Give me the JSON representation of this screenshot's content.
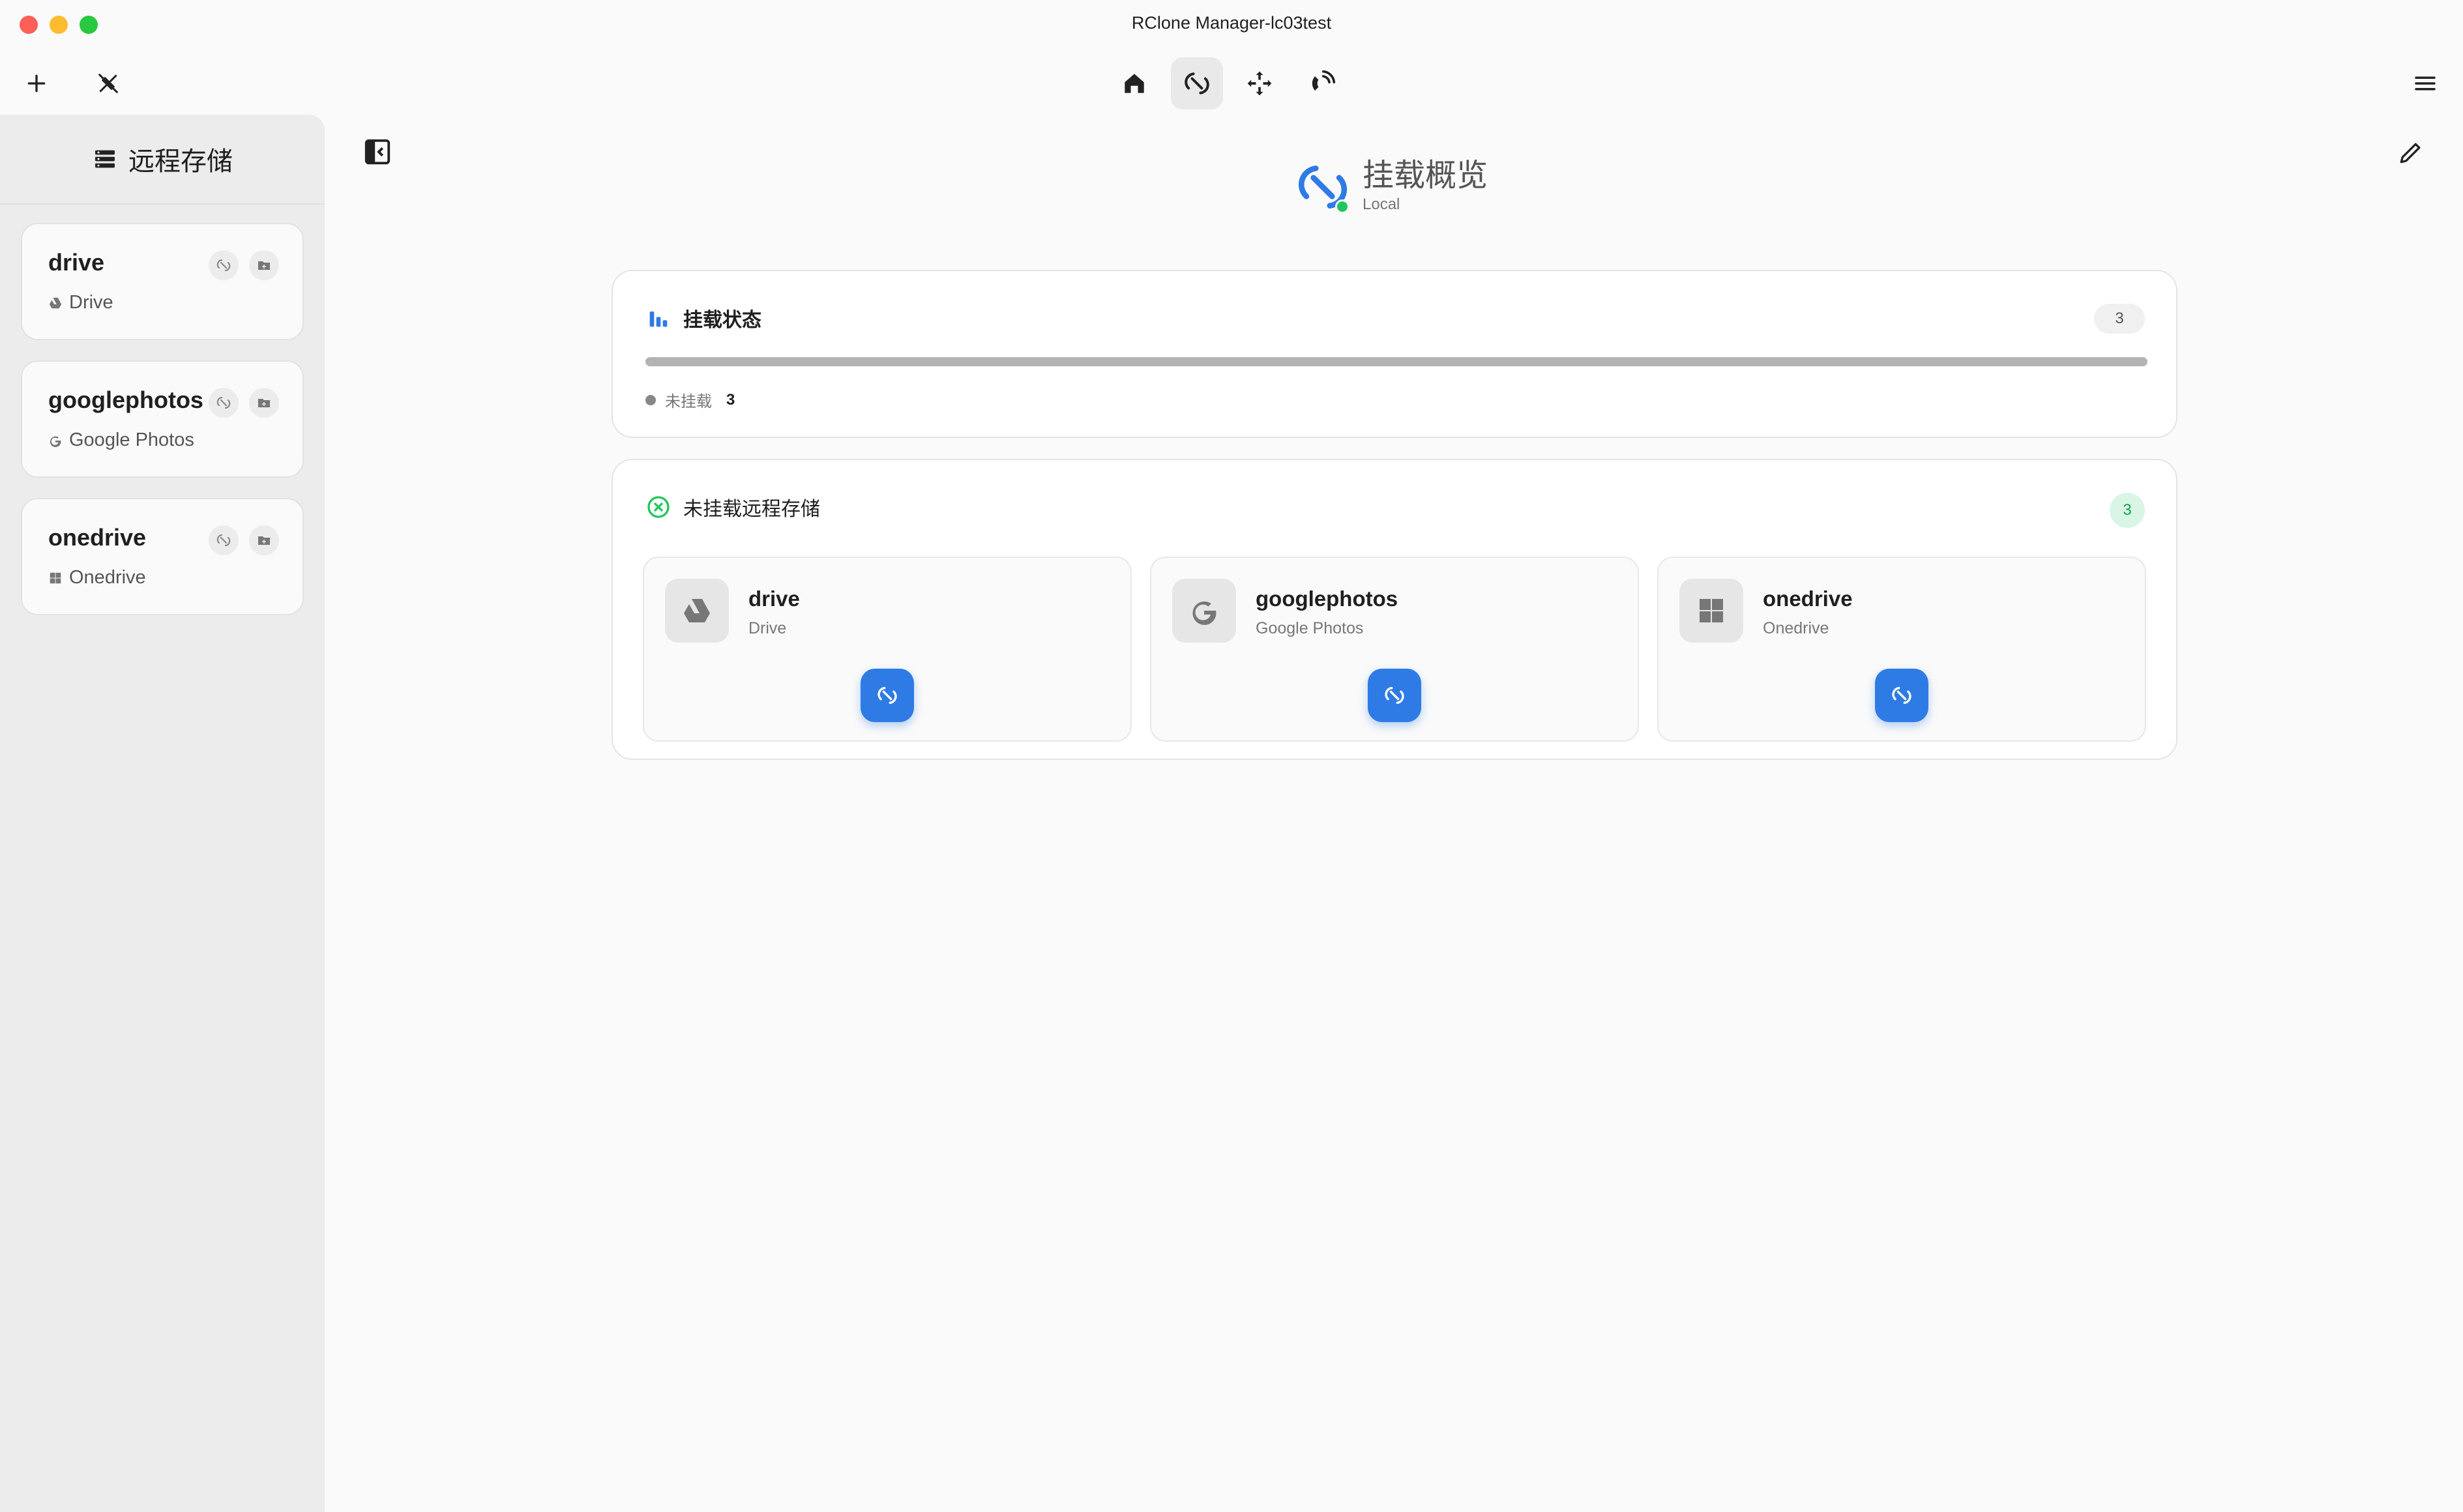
{
  "window": {
    "title": "RClone Manager-lc03test"
  },
  "toolbar": {
    "add_icon": "plus-icon",
    "tools_icon": "unplug-icon",
    "tabs": [
      {
        "name": "home",
        "icon": "home-icon",
        "active": false
      },
      {
        "name": "mount",
        "icon": "mount-icon",
        "active": true
      },
      {
        "name": "sync",
        "icon": "move-icon",
        "active": false
      },
      {
        "name": "serve",
        "icon": "broadcast-icon",
        "active": false
      }
    ],
    "menu_icon": "hamburger-icon"
  },
  "sidebar": {
    "title": "远程存储",
    "remotes": [
      {
        "name": "drive",
        "type": "Drive",
        "type_icon": "google-drive-icon"
      },
      {
        "name": "googlephotos",
        "type": "Google Photos",
        "type_icon": "google-icon"
      },
      {
        "name": "onedrive",
        "type": "Onedrive",
        "type_icon": "windows-icon"
      }
    ]
  },
  "main": {
    "title": "挂载概览",
    "subtitle": "Local",
    "status_panel": {
      "title": "挂载状态",
      "count": "3",
      "progress_fraction": 1.0,
      "legend_label": "未挂载",
      "legend_count": "3"
    },
    "unmounted_panel": {
      "title": "未挂载远程存储",
      "count": "3",
      "cards": [
        {
          "name": "drive",
          "type": "Drive",
          "icon": "google-drive-icon"
        },
        {
          "name": "googlephotos",
          "type": "Google Photos",
          "icon": "google-icon"
        },
        {
          "name": "onedrive",
          "type": "Onedrive",
          "icon": "windows-icon"
        }
      ]
    }
  },
  "colors": {
    "accent": "#2f7be5",
    "online": "#22c55e",
    "unmounted_badge": "#d9f5e6",
    "unmounted_text": "#16a34a"
  }
}
